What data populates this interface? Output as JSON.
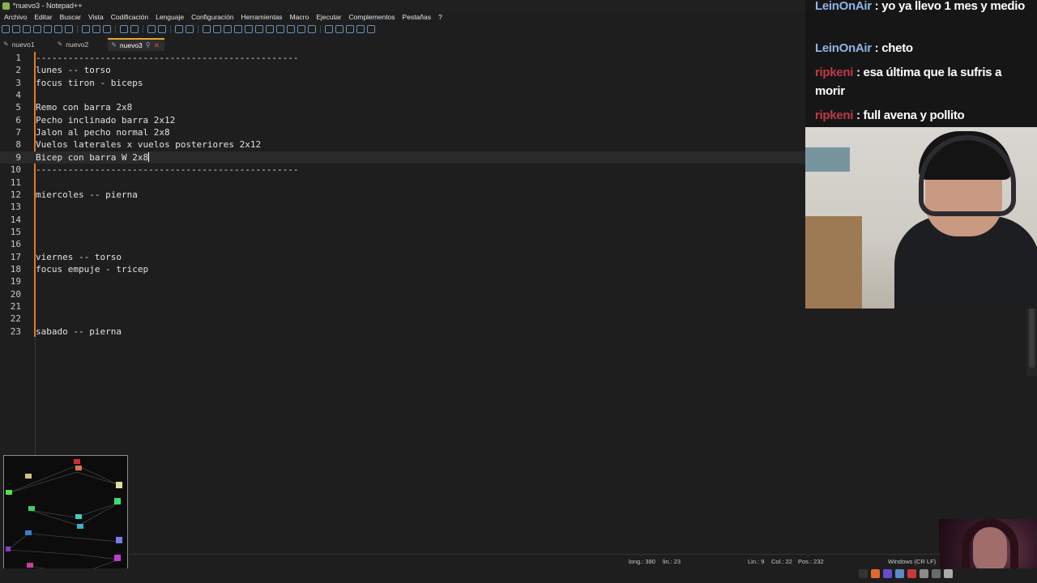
{
  "window": {
    "title": "*nuevo3 - Notepad++"
  },
  "menu": [
    "Archivo",
    "Editar",
    "Buscar",
    "Vista",
    "Codificación",
    "Lenguaje",
    "Configuración",
    "Herramientas",
    "Macro",
    "Ejecutar",
    "Complementos",
    "Pestañas",
    "?"
  ],
  "tabs": [
    {
      "label": "nuevo1",
      "active": false
    },
    {
      "label": "nuevo2",
      "active": false
    },
    {
      "label": "nuevo3",
      "active": true
    }
  ],
  "lines": [
    {
      "num": "1",
      "text": "-------------------------------------------------"
    },
    {
      "num": "2",
      "text": "lunes -- torso"
    },
    {
      "num": "3",
      "text": "focus tiron - biceps"
    },
    {
      "num": "4",
      "text": ""
    },
    {
      "num": "5",
      "text": "Remo con barra 2x8"
    },
    {
      "num": "6",
      "text": "Pecho inclinado barra 2x12"
    },
    {
      "num": "7",
      "text": "Jalon al pecho normal 2x8"
    },
    {
      "num": "8",
      "text": "Vuelos laterales x vuelos posteriores 2x12"
    },
    {
      "num": "9",
      "text": "Bicep con barra W 2x8"
    },
    {
      "num": "10",
      "text": "-------------------------------------------------"
    },
    {
      "num": "11",
      "text": ""
    },
    {
      "num": "12",
      "text": "miercoles -- pierna"
    },
    {
      "num": "13",
      "text": ""
    },
    {
      "num": "14",
      "text": ""
    },
    {
      "num": "15",
      "text": ""
    },
    {
      "num": "16",
      "text": ""
    },
    {
      "num": "17",
      "text": "viernes -- torso"
    },
    {
      "num": "18",
      "text": "focus empuje - tricep"
    },
    {
      "num": "19",
      "text": ""
    },
    {
      "num": "20",
      "text": ""
    },
    {
      "num": "21",
      "text": ""
    },
    {
      "num": "22",
      "text": ""
    },
    {
      "num": "23",
      "text": "sabado -- pierna"
    }
  ],
  "current_line": 9,
  "status": {
    "length": "long.: 380",
    "lines": "lin.: 23",
    "ln": "Lin.: 9",
    "col": "Col.: 22",
    "pos": "Pos.: 232",
    "eol": "Windows (CR LF)"
  },
  "chat": [
    {
      "user": "LeinOnAir",
      "color": "#8fb4e8",
      "message": "yo ya llevo 1 mes y medio"
    },
    {
      "user": "LeinOnAir",
      "color": "#8fb4e8",
      "message": "cheto"
    },
    {
      "user": "ripkeni",
      "color": "#c0394a",
      "message": "esa última que la sufris a morir"
    },
    {
      "user": "ripkeni",
      "color": "#c0394a",
      "message": "full avena y pollito"
    }
  ],
  "colors": {
    "accent": "#e8a33d",
    "fold_marker": "#e07b2a",
    "background": "#1e1e1e"
  }
}
